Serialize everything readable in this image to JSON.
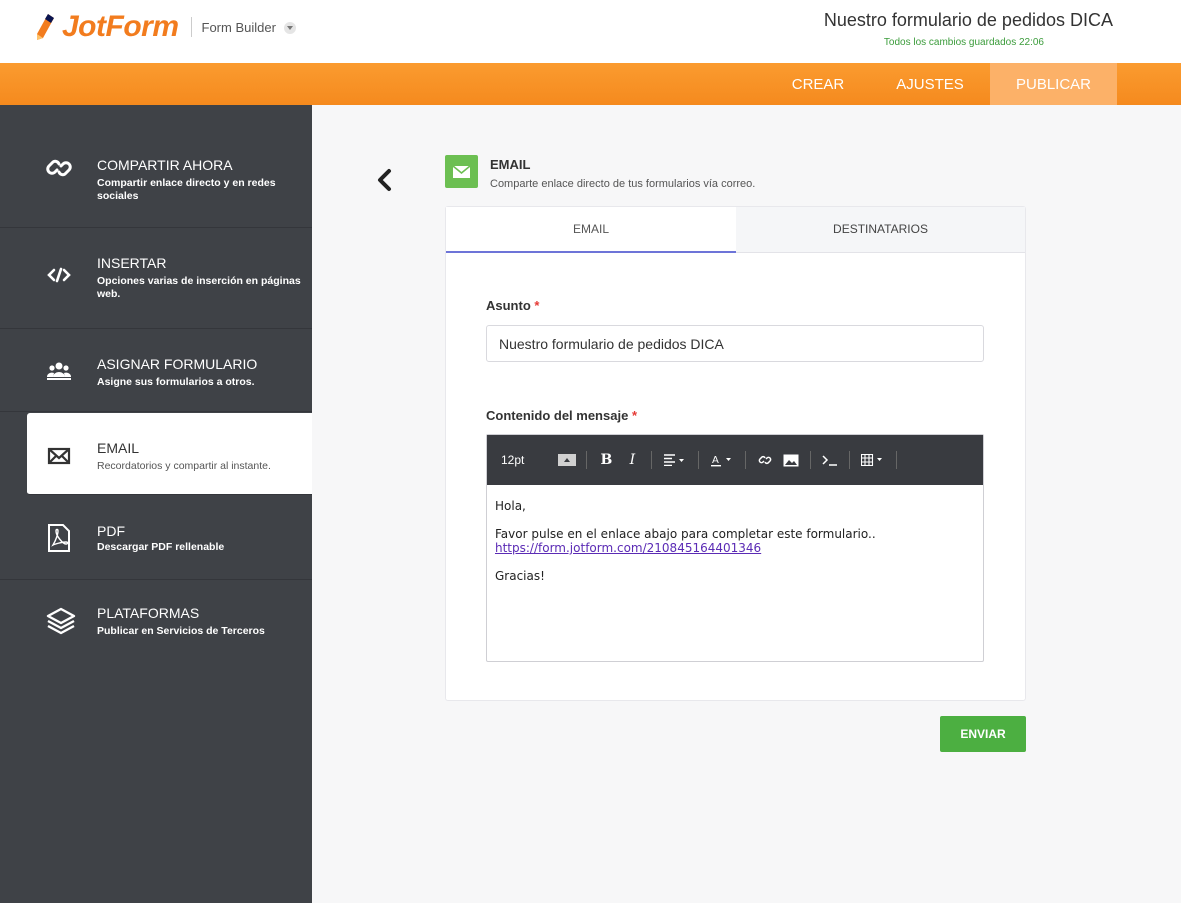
{
  "header": {
    "logo_text": "JotForm",
    "builder_label": "Form Builder",
    "form_title": "Nuestro formulario de pedidos DICA",
    "save_status": "Todos los cambios guardados 22:06"
  },
  "nav": {
    "items": [
      {
        "label": "CREAR"
      },
      {
        "label": "AJUSTES"
      },
      {
        "label": "PUBLICAR"
      }
    ],
    "active": "PUBLICAR",
    "color": "#f7931e"
  },
  "sidebar": {
    "items": [
      {
        "title": "COMPARTIR AHORA",
        "desc": "Compartir enlace directo y en redes sociales",
        "icon": "link-icon"
      },
      {
        "title": "INSERTAR",
        "desc": "Opciones varias de inserción en páginas web.",
        "icon": "code-icon"
      },
      {
        "title": "ASIGNAR FORMULARIO",
        "desc": "Asigne sus formularios a otros.",
        "icon": "users-icon"
      },
      {
        "title": "EMAIL",
        "desc": "Recordatorios y compartir al instante.",
        "icon": "envelope-icon"
      },
      {
        "title": "PDF",
        "desc": "Descargar PDF rellenable",
        "icon": "pdf-icon"
      },
      {
        "title": "PLATAFORMAS",
        "desc": "Publicar en Servicios de Terceros",
        "icon": "layers-icon"
      }
    ],
    "active": "EMAIL"
  },
  "main": {
    "section_title": "EMAIL",
    "section_desc": "Comparte enlace directo de tus formularios vía correo.",
    "tabs": [
      {
        "label": "EMAIL"
      },
      {
        "label": "DESTINATARIOS"
      }
    ],
    "subject_label": "Asunto",
    "subject_value": "Nuestro formulario de pedidos DICA",
    "message_label": "Contenido del mensaje",
    "required_mark": "*",
    "toolbar_font_size": "12pt",
    "message": {
      "greeting": "Hola,",
      "body": "Favor pulse en el enlace abajo para completar este formulario..",
      "link": "https://form.jotform.com/210845164401346",
      "closing": "Gracias!"
    },
    "send_label": "ENVIAR"
  }
}
